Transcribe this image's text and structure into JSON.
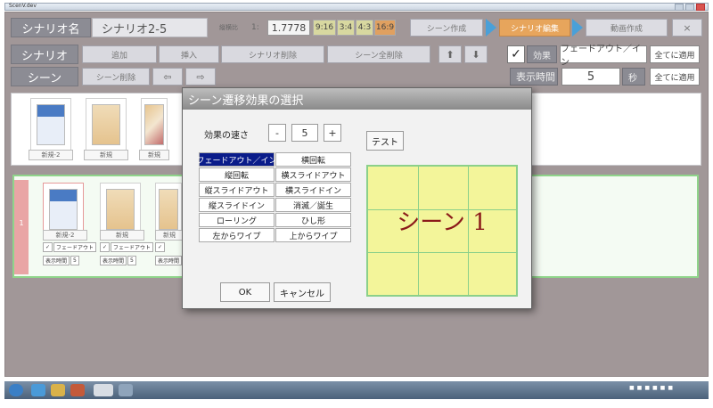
{
  "window": {
    "title": "ScenV.dev"
  },
  "header": {
    "scenario_name_label": "シナリオ名",
    "scenario_name_value": "シナリオ2-5",
    "aspect_label": "縦横比",
    "aspect_prefix": "1:",
    "aspect_value": "1.7778",
    "ratios": [
      "9:16",
      "3:4",
      "4:3",
      "16:9"
    ],
    "steps": [
      "シーン作成",
      "シナリオ編集",
      "動画作成"
    ],
    "close": "×"
  },
  "scenario_bar": {
    "label": "シナリオ",
    "buttons": [
      "追加",
      "挿入",
      "シナリオ削除",
      "シーン全削除"
    ]
  },
  "scene_bar": {
    "label": "シーン",
    "delete": "シーン削除"
  },
  "effect_bar": {
    "effect_label": "効果",
    "effect_value": "フェードアウト／イン",
    "apply_all": "全てに適用",
    "time_label": "表示時間",
    "time_value": "5",
    "time_unit": "秒",
    "apply_all_2": "全てに適用"
  },
  "top_thumbs": [
    "新規-2",
    "新規",
    "新規"
  ],
  "bottom_thumbs": [
    "新規-2",
    "新規",
    "新規"
  ],
  "bottom_meta": {
    "number": "1",
    "effect": "フェードアウト",
    "time_label": "表示時間",
    "time_value": "5"
  },
  "dialog": {
    "title": "シーン遷移効果の選択",
    "speed_label": "効果の速さ",
    "minus": "-",
    "speed_value": "5",
    "plus": "+",
    "test": "テスト",
    "effects": [
      "フェードアウト／イン",
      "横回転",
      "縦回転",
      "横スライドアウト",
      "縦スライドアウト",
      "横スライドイン",
      "縦スライドイン",
      "消滅／誕生",
      "ローリング",
      "ひし形",
      "左からワイプ",
      "上からワイプ"
    ],
    "selected_index": 0,
    "preview_text": "シーン 1",
    "ok": "OK",
    "cancel": "キャンセル"
  },
  "colors": {
    "accent": "#e7a55c",
    "arrow": "#4aa0d8",
    "selected": "#0a1c8a",
    "preview_bg": "#f3f59a",
    "preview_grid": "#8bd08a"
  }
}
